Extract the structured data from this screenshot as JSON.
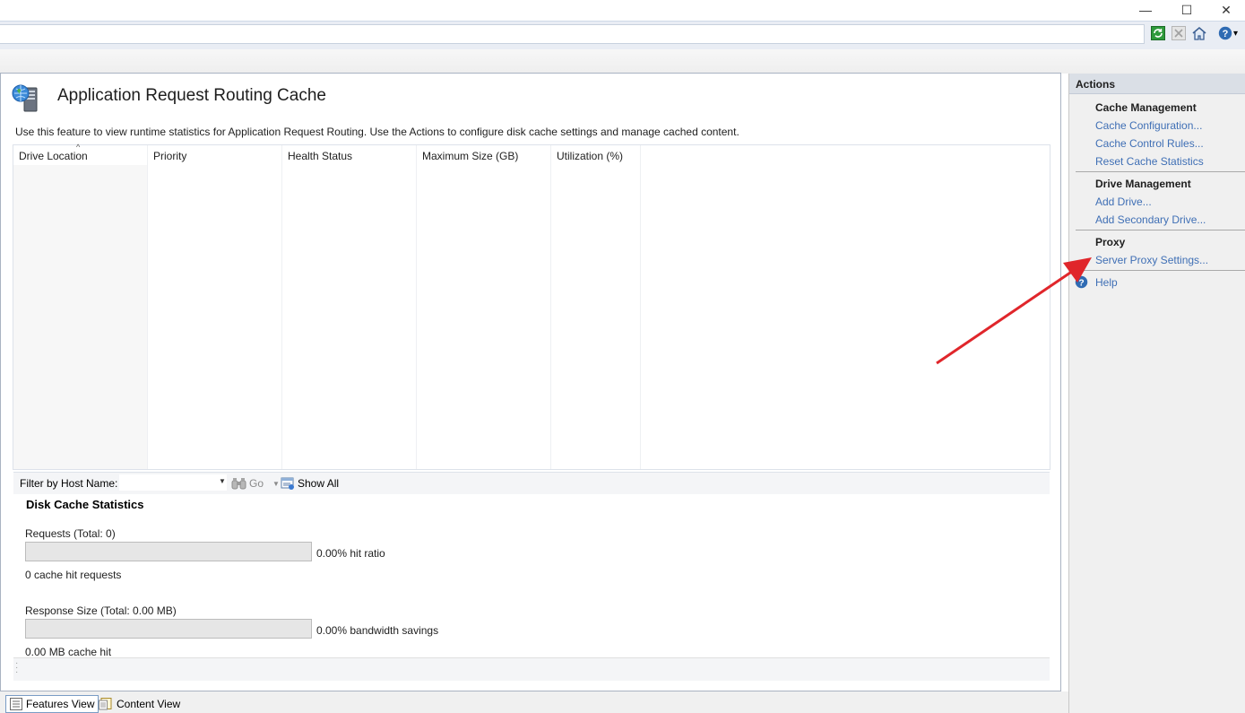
{
  "window": {
    "minimize_glyph": "—",
    "maximize_glyph": "☐",
    "close_glyph": "✕"
  },
  "toolbar": {
    "icons": [
      "refresh-icon",
      "stop-icon",
      "home-icon",
      "help-icon"
    ],
    "help_dropdown_glyph": "▾"
  },
  "page": {
    "title": "Application Request Routing Cache",
    "description": "Use this feature to view runtime statistics for Application Request Routing.  Use the Actions to configure disk cache settings and manage cached content."
  },
  "grid": {
    "columns": [
      "Drive Location",
      "Priority",
      "Health Status",
      "Maximum Size (GB)",
      "Utilization (%)"
    ],
    "sort_glyph": "^",
    "rows": []
  },
  "filter": {
    "label": "Filter by Host Name:",
    "value": "",
    "go_label": "Go",
    "show_all_label": "Show All"
  },
  "stats": {
    "title": "Disk Cache Statistics",
    "requests_label": "Requests (Total: 0)",
    "hit_ratio_text": "0.00% hit ratio",
    "hit_ratio_value": 0,
    "cache_hit_requests": "0 cache hit requests",
    "response_size_label": "Response Size (Total: 0.00 MB)",
    "bandwidth_text": "0.00% bandwidth savings",
    "bandwidth_value": 0,
    "cache_hit_size": "0.00 MB cache hit"
  },
  "views": {
    "features": "Features View",
    "content": "Content View"
  },
  "actions": {
    "title": "Actions",
    "groups": [
      {
        "heading": "Cache Management",
        "links": [
          "Cache Configuration...",
          "Cache Control Rules...",
          "Reset Cache Statistics"
        ]
      },
      {
        "heading": "Drive Management",
        "links": [
          "Add Drive...",
          "Add Secondary Drive..."
        ]
      },
      {
        "heading": "Proxy",
        "links": [
          "Server Proxy Settings..."
        ]
      }
    ],
    "help": "Help"
  },
  "colors": {
    "link": "#3f6fb5",
    "annotation_arrow": "#e0262b"
  }
}
